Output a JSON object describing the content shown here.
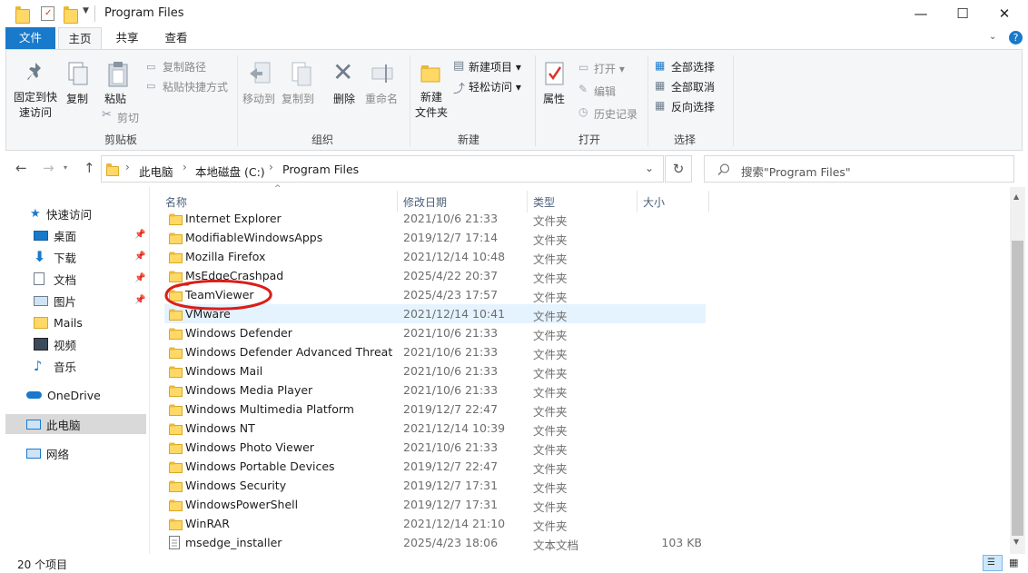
{
  "window": {
    "title": "Program Files",
    "minimize_glyph": "—",
    "maximize_glyph": "☐",
    "close_glyph": "✕"
  },
  "ribbon_tabs": {
    "file": "文件",
    "home": "主页",
    "share": "共享",
    "view": "查看"
  },
  "ribbon": {
    "clipboard": {
      "pin": "固定到快速访问",
      "pin_line1": "固定到快",
      "pin_line2": "速访问",
      "copy": "复制",
      "paste": "粘贴",
      "copy_path": "复制路径",
      "paste_shortcut": "粘贴快捷方式",
      "cut": "剪切",
      "group": "剪贴板"
    },
    "organize": {
      "move_to": "移动到",
      "copy_to": "复制到",
      "delete": "删除",
      "rename": "重命名",
      "group": "组织"
    },
    "new": {
      "new_folder_line1": "新建",
      "new_folder_line2": "文件夹",
      "new_item": "新建项目",
      "easy_access": "轻松访问",
      "group": "新建"
    },
    "open": {
      "properties": "属性",
      "open": "打开",
      "edit": "编辑",
      "history": "历史记录",
      "group": "打开"
    },
    "select": {
      "select_all": "全部选择",
      "select_none": "全部取消",
      "invert": "反向选择",
      "group": "选择"
    }
  },
  "address": {
    "back": "←",
    "forward": "→",
    "up": "↑",
    "breadcrumb": [
      "此电脑",
      "本地磁盘 (C:)",
      "Program Files"
    ],
    "refresh": "↻",
    "search_placeholder": "搜索\"Program Files\""
  },
  "nav": {
    "quick_access": "快速访问",
    "desktop": "桌面",
    "downloads": "下载",
    "documents": "文档",
    "pictures": "图片",
    "mails": "Mails",
    "videos": "视频",
    "music": "音乐",
    "onedrive": "OneDrive",
    "this_pc": "此电脑",
    "network": "网络"
  },
  "columns": {
    "name": "名称",
    "date": "修改日期",
    "type": "类型",
    "size": "大小"
  },
  "files": [
    {
      "name": "Internet Explorer",
      "date": "2021/10/6 21:33",
      "type": "文件夹",
      "size": ""
    },
    {
      "name": "ModifiableWindowsApps",
      "date": "2019/12/7 17:14",
      "type": "文件夹",
      "size": ""
    },
    {
      "name": "Mozilla Firefox",
      "date": "2021/12/14 10:48",
      "type": "文件夹",
      "size": ""
    },
    {
      "name": "MsEdgeCrashpad",
      "date": "2025/4/22 20:37",
      "type": "文件夹",
      "size": ""
    },
    {
      "name": "TeamViewer",
      "date": "2025/4/23 17:57",
      "type": "文件夹",
      "size": ""
    },
    {
      "name": "VMware",
      "date": "2021/12/14 10:41",
      "type": "文件夹",
      "size": ""
    },
    {
      "name": "Windows Defender",
      "date": "2021/10/6 21:33",
      "type": "文件夹",
      "size": ""
    },
    {
      "name": "Windows Defender Advanced Threat ...",
      "date": "2021/10/6 21:33",
      "type": "文件夹",
      "size": ""
    },
    {
      "name": "Windows Mail",
      "date": "2021/10/6 21:33",
      "type": "文件夹",
      "size": ""
    },
    {
      "name": "Windows Media Player",
      "date": "2021/10/6 21:33",
      "type": "文件夹",
      "size": ""
    },
    {
      "name": "Windows Multimedia Platform",
      "date": "2019/12/7 22:47",
      "type": "文件夹",
      "size": ""
    },
    {
      "name": "Windows NT",
      "date": "2021/12/14 10:39",
      "type": "文件夹",
      "size": ""
    },
    {
      "name": "Windows Photo Viewer",
      "date": "2021/10/6 21:33",
      "type": "文件夹",
      "size": ""
    },
    {
      "name": "Windows Portable Devices",
      "date": "2019/12/7 22:47",
      "type": "文件夹",
      "size": ""
    },
    {
      "name": "Windows Security",
      "date": "2019/12/7 17:31",
      "type": "文件夹",
      "size": ""
    },
    {
      "name": "WindowsPowerShell",
      "date": "2019/12/7 17:31",
      "type": "文件夹",
      "size": ""
    },
    {
      "name": "WinRAR",
      "date": "2021/12/14 21:10",
      "type": "文件夹",
      "size": ""
    },
    {
      "name": "msedge_installer",
      "date": "2025/4/23 18:06",
      "type": "文本文档",
      "size": "103 KB"
    }
  ],
  "status": {
    "item_count": "20 个项目"
  },
  "colors": {
    "accent": "#1979ca",
    "selection": "#e5f3ff",
    "annotation": "#d91e18"
  }
}
